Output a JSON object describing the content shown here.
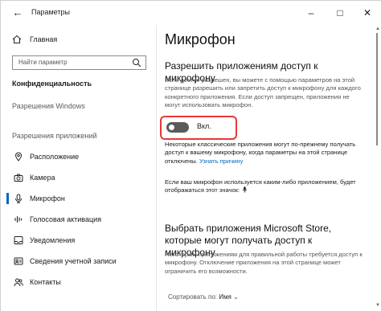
{
  "titlebar": {
    "title": "Параметры"
  },
  "sidebar": {
    "home_label": "Главная",
    "search_placeholder": "Найти параметр",
    "section_privacy": "Конфиденциальность",
    "section_windows_perms": "Разрешения Windows",
    "section_app_perms": "Разрешения приложений",
    "items": [
      {
        "label": "Расположение",
        "icon": "location-icon"
      },
      {
        "label": "Камера",
        "icon": "camera-icon"
      },
      {
        "label": "Микрофон",
        "icon": "microphone-icon",
        "active": true
      },
      {
        "label": "Голосовая активация",
        "icon": "voice-activation-icon"
      },
      {
        "label": "Уведомления",
        "icon": "notifications-icon"
      },
      {
        "label": "Сведения учетной записи",
        "icon": "account-info-icon"
      },
      {
        "label": "Контакты",
        "icon": "contacts-icon"
      }
    ]
  },
  "main": {
    "title": "Микрофон",
    "section1_title": "Разрешить приложениям доступ к микрофону",
    "section1_desc": "Если доступ разрешен, вы можете с помощью параметров на этой странице разрешить или запретить доступ к микрофону для каждого конкретного приложения. Если доступ запрещен, приложения не могут использовать микрофон.",
    "toggle_label": "Вкл.",
    "toggle_on": true,
    "classic_note": "Некоторые классические приложения могут по-прежнему получать доступ к вашему микрофону, когда параметры на этой странице отключены.",
    "learn_why_link": "Узнать причину",
    "in_use_note": "Если ваш микрофон используется каким-либо приложением, будет отображаться этот значок:",
    "section2_title": "Выбрать приложения Microsoft Store, которые могут получать доступ к микрофону",
    "section2_desc": "Некоторым приложениям для правильной работы требуется доступ к микрофону. Отключение приложения на этой странице может ограничить его возможности.",
    "sort_label": "Сортировать по:",
    "sort_value": "Имя"
  },
  "colors": {
    "accent": "#0067c0",
    "highlight_border": "#e53935",
    "toggle_bg": "#5a5a5a"
  }
}
